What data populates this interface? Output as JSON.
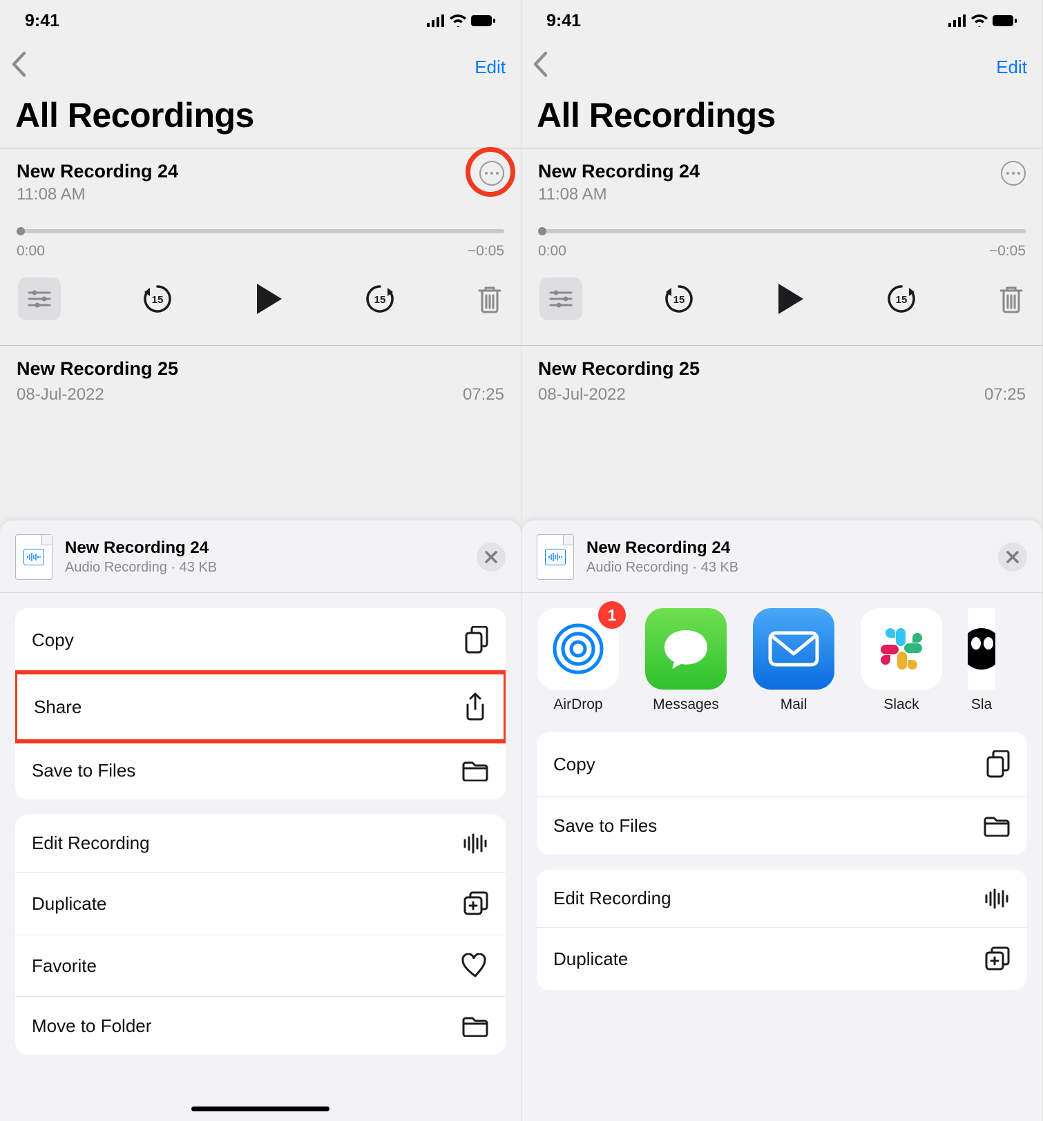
{
  "status": {
    "time": "9:41"
  },
  "nav": {
    "edit": "Edit"
  },
  "page_title": "All Recordings",
  "active_recording": {
    "name": "New Recording 24",
    "subtitle": "11:08 AM",
    "elapsed": "0:00",
    "remaining": "−0:05"
  },
  "second_recording": {
    "name": "New Recording 25",
    "date": "08-Jul-2022",
    "duration": "07:25"
  },
  "sheet": {
    "file_title": "New Recording 24",
    "file_meta": "Audio Recording · 43 KB",
    "airdrop_badge": "1",
    "apps": {
      "airdrop": "AirDrop",
      "messages": "Messages",
      "mail": "Mail",
      "slack": "Slack",
      "safari": "Sla"
    },
    "actions": {
      "copy": "Copy",
      "share": "Share",
      "save_files": "Save to Files",
      "edit_recording": "Edit Recording",
      "duplicate": "Duplicate",
      "favorite": "Favorite",
      "move_folder": "Move to Folder"
    }
  }
}
